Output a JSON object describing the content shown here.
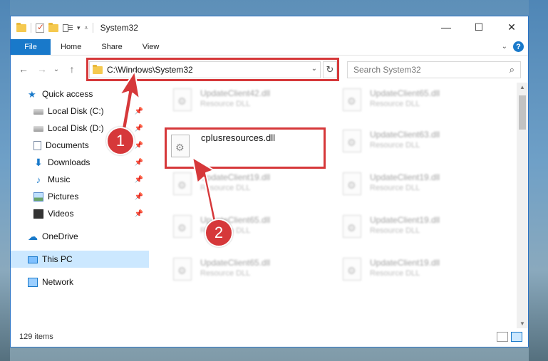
{
  "window": {
    "title": "System32",
    "controls": [
      "—",
      "☐",
      "✕"
    ]
  },
  "ribbon": {
    "tabs": [
      "File",
      "Home",
      "Share",
      "View"
    ],
    "help": "?"
  },
  "address": {
    "path": "C:\\Windows\\System32",
    "search_placeholder": "Search System32"
  },
  "sidebar": {
    "items": [
      {
        "label": "Quick access",
        "icon": "star-icon"
      },
      {
        "label": "Local Disk (C:)",
        "icon": "disk-icon",
        "pinned": true
      },
      {
        "label": "Local Disk (D:)",
        "icon": "disk-icon",
        "pinned": true
      },
      {
        "label": "Documents",
        "icon": "documents-icon",
        "pinned": true
      },
      {
        "label": "Downloads",
        "icon": "downloads-icon",
        "pinned": true
      },
      {
        "label": "Music",
        "icon": "music-icon",
        "pinned": true
      },
      {
        "label": "Pictures",
        "icon": "pictures-icon",
        "pinned": true
      },
      {
        "label": "Videos",
        "icon": "videos-icon",
        "pinned": true
      },
      {
        "label": "OneDrive",
        "icon": "onedrive-icon"
      },
      {
        "label": "This PC",
        "icon": "this-pc-icon",
        "selected": true
      },
      {
        "label": "Network",
        "icon": "network-icon"
      }
    ]
  },
  "files": {
    "focused": {
      "name": "cplusresources.dll"
    },
    "blurred": [
      {
        "name": "UpdateClient42.dll",
        "desc": "Resource DLL"
      },
      {
        "name": "UpdateClient65.dll",
        "desc": "Resource DLL"
      },
      {
        "name": "UpdateClient63.dll",
        "desc": "Resource DLL"
      },
      {
        "name": "UpdateClient19.dll",
        "desc": "Resource DLL"
      },
      {
        "name": "UpdateClient19.dll",
        "desc": "Resource DLL"
      },
      {
        "name": "UpdateClient65.dll",
        "desc": "Resource DLL"
      },
      {
        "name": "UpdateClient19.dll",
        "desc": "Resource DLL"
      },
      {
        "name": "UpdateClient65.dll",
        "desc": "Resource DLL"
      },
      {
        "name": "UpdateClient19.dll",
        "desc": "Resource DLL"
      }
    ]
  },
  "status": {
    "item_count": "129 items"
  },
  "annotations": {
    "step1": "1",
    "step2": "2",
    "color": "#d6383a"
  }
}
